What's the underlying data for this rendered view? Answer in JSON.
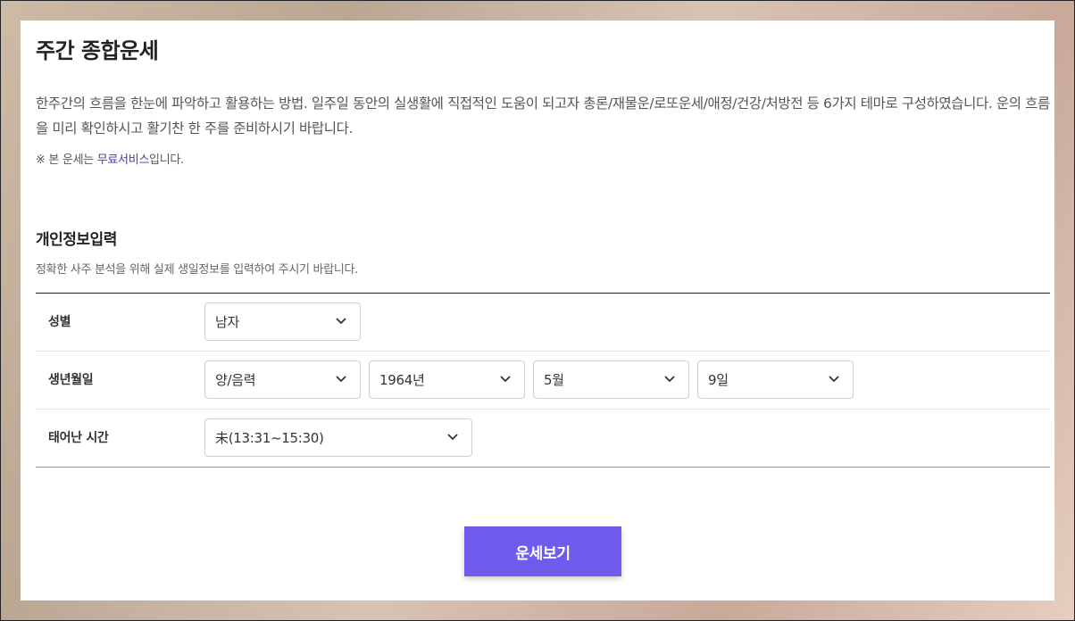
{
  "header": {
    "title": "주간 종합운세",
    "description": "한주간의 흐름을 한눈에 파악하고 활용하는 방법. 일주일 동안의 실생활에 직접적인 도움이 되고자 총론/재물운/로또운세/애정/건강/처방전 등 6가지 테마로 구성하였습니다. 운의 흐름을 미리 확인하시고 활기찬 한 주를 준비하시기 바랍니다.",
    "notice_prefix": "※ 본 운세는 ",
    "notice_highlight": "무료서비스",
    "notice_suffix": "입니다."
  },
  "section": {
    "title": "개인정보입력",
    "subtitle": "정확한 사주 분석을 위해 실제 생일정보를 입력하여 주시기 바랍니다."
  },
  "form": {
    "gender": {
      "label": "성별",
      "value": "남자"
    },
    "birth": {
      "label": "생년월일",
      "calendar": "양/음력",
      "year": "1964년",
      "month": "5월",
      "day": "9일"
    },
    "time": {
      "label": "태어난 시간",
      "value": "未(13:31~15:30)"
    }
  },
  "submit_label": "운세보기",
  "colors": {
    "accent": "#6f5cec",
    "highlight_text": "#4b3aa8"
  },
  "icons": {
    "select_arrow": "chevron-down-icon"
  }
}
